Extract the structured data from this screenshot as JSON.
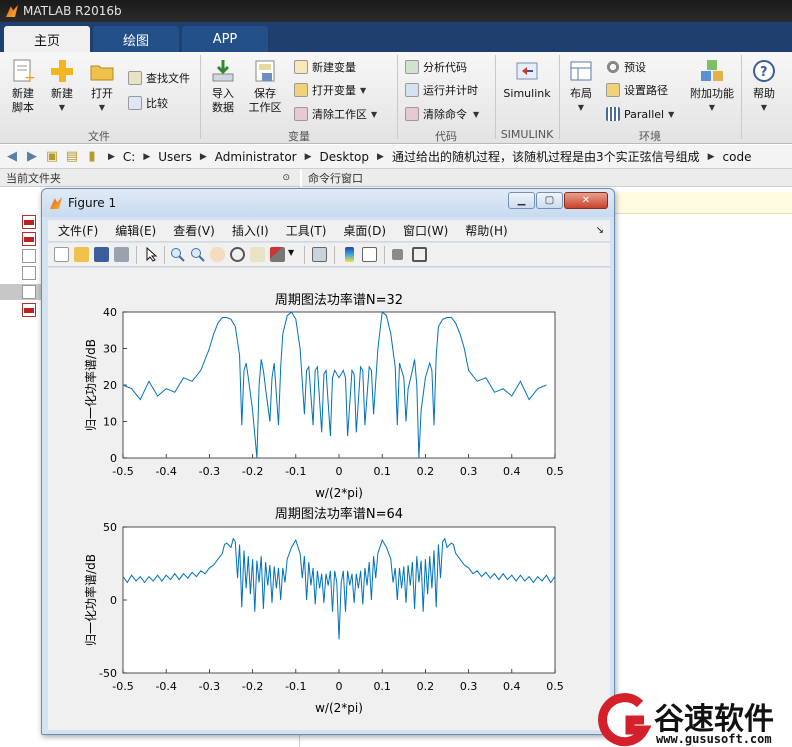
{
  "app": {
    "title": "MATLAB R2016b"
  },
  "tabs": [
    {
      "label": "主页",
      "active": true
    },
    {
      "label": "绘图",
      "active": false
    },
    {
      "label": "APP",
      "active": false
    }
  ],
  "ribbon": {
    "file": {
      "section": "文件",
      "new_script": "新建\n脚本",
      "new": "新建",
      "open": "打开",
      "find_files": "查找文件",
      "compare": "比较"
    },
    "variable": {
      "section": "变量",
      "import": "导入\n数据",
      "save_ws": "保存\n工作区",
      "new_var": "新建变量",
      "open_var": "打开变量",
      "clear_ws": "清除工作区"
    },
    "code": {
      "section": "代码",
      "analyze": "分析代码",
      "run_time": "运行并计时",
      "clear_cmd": "清除命令"
    },
    "simulink": {
      "section": "SIMULINK",
      "label": "Simulink"
    },
    "env": {
      "section": "环境",
      "layout": "布局",
      "prefs": "预设",
      "set_path": "设置路径",
      "parallel": "Parallel",
      "addons": "附加功能"
    },
    "help": "帮助"
  },
  "address": {
    "path": [
      "C:",
      "Users",
      "Administrator",
      "Desktop",
      "通过给出的随机过程，该随机过程是由3个实正弦信号组成",
      "code"
    ]
  },
  "panels": {
    "current_folder": "当前文件夹",
    "command_window": "命令行窗口"
  },
  "figure": {
    "title": "Figure 1",
    "menu": [
      "文件(F)",
      "编辑(E)",
      "查看(V)",
      "插入(I)",
      "工具(T)",
      "桌面(D)",
      "窗口(W)",
      "帮助(H)"
    ]
  },
  "chart_data": [
    {
      "type": "line",
      "title": "周期图法功率谱N=32",
      "xlabel": "w/(2*pi)",
      "ylabel": "归一化功率谱/dB",
      "xlim": [
        -0.5,
        0.5
      ],
      "ylim": [
        0,
        40
      ],
      "xticks": [
        "-0.5",
        "-0.4",
        "-0.3",
        "-0.2",
        "-0.1",
        "0",
        "0.1",
        "0.2",
        "0.3",
        "0.4",
        "0.5"
      ],
      "yticks": [
        "0",
        "10",
        "20",
        "30",
        "40"
      ],
      "color": "#0072bd",
      "x": [
        -0.5,
        -0.48,
        -0.46,
        -0.44,
        -0.42,
        -0.4,
        -0.38,
        -0.36,
        -0.34,
        -0.32,
        -0.3,
        -0.29,
        -0.28,
        -0.27,
        -0.26,
        -0.25,
        -0.24,
        -0.23,
        -0.225,
        -0.22,
        -0.215,
        -0.21,
        -0.2,
        -0.19,
        -0.185,
        -0.18,
        -0.175,
        -0.17,
        -0.16,
        -0.155,
        -0.15,
        -0.14,
        -0.135,
        -0.13,
        -0.12,
        -0.11,
        -0.1,
        -0.09,
        -0.08,
        -0.075,
        -0.07,
        -0.06,
        -0.055,
        -0.05,
        -0.04,
        -0.035,
        -0.03,
        -0.02,
        -0.015,
        -0.01,
        0,
        0.01,
        0.015,
        0.02,
        0.03,
        0.035,
        0.04,
        0.05,
        0.055,
        0.06,
        0.07,
        0.075,
        0.08,
        0.09,
        0.1,
        0.11,
        0.12,
        0.13,
        0.135,
        0.14,
        0.15,
        0.155,
        0.16,
        0.17,
        0.175,
        0.18,
        0.185,
        0.19,
        0.2,
        0.21,
        0.215,
        0.22,
        0.225,
        0.23,
        0.24,
        0.25,
        0.26,
        0.27,
        0.28,
        0.29,
        0.3,
        0.32,
        0.34,
        0.36,
        0.38,
        0.4,
        0.42,
        0.44,
        0.46,
        0.48,
        0.5
      ],
      "y": [
        20,
        19,
        16,
        21,
        17,
        19,
        18,
        22,
        21,
        24,
        30,
        34,
        37,
        38.5,
        38.5,
        38,
        36,
        28,
        9,
        24,
        26,
        22,
        13,
        0,
        20,
        27,
        24,
        19,
        10,
        22,
        26,
        9,
        25,
        34,
        39,
        40,
        38,
        30,
        12,
        24,
        25,
        9,
        24,
        25,
        7,
        23,
        24,
        6,
        22,
        24,
        22,
        24,
        22,
        6,
        24,
        23,
        7,
        25,
        24,
        9,
        25,
        24,
        12,
        30,
        40,
        39,
        34,
        25,
        9,
        26,
        22,
        10,
        19,
        24,
        27,
        20,
        0,
        13,
        22,
        26,
        24,
        9,
        28,
        36,
        38,
        38.5,
        38.5,
        37,
        34,
        30,
        24,
        21,
        22,
        18,
        19,
        17,
        21,
        16,
        19,
        20
      ]
    },
    {
      "type": "line",
      "title": "周期图法功率谱N=64",
      "xlabel": "w/(2*pi)",
      "ylabel": "归一化功率谱/dB",
      "xlim": [
        -0.5,
        0.5
      ],
      "ylim": [
        -50,
        50
      ],
      "xticks": [
        "-0.5",
        "-0.4",
        "-0.3",
        "-0.2",
        "-0.1",
        "0",
        "0.1",
        "0.2",
        "0.3",
        "0.4",
        "0.5"
      ],
      "yticks": [
        "-50",
        "0",
        "50"
      ],
      "color": "#0072bd",
      "x": [
        -0.5,
        -0.49,
        -0.48,
        -0.47,
        -0.46,
        -0.45,
        -0.44,
        -0.43,
        -0.42,
        -0.41,
        -0.4,
        -0.39,
        -0.38,
        -0.37,
        -0.36,
        -0.35,
        -0.34,
        -0.33,
        -0.32,
        -0.31,
        -0.3,
        -0.29,
        -0.28,
        -0.27,
        -0.265,
        -0.26,
        -0.25,
        -0.245,
        -0.24,
        -0.235,
        -0.23,
        -0.225,
        -0.22,
        -0.215,
        -0.21,
        -0.205,
        -0.2,
        -0.195,
        -0.19,
        -0.185,
        -0.18,
        -0.175,
        -0.17,
        -0.165,
        -0.16,
        -0.155,
        -0.15,
        -0.145,
        -0.14,
        -0.135,
        -0.13,
        -0.125,
        -0.12,
        -0.11,
        -0.1,
        -0.09,
        -0.085,
        -0.08,
        -0.075,
        -0.07,
        -0.065,
        -0.06,
        -0.055,
        -0.05,
        -0.045,
        -0.04,
        -0.035,
        -0.03,
        -0.025,
        -0.02,
        -0.015,
        -0.01,
        -0.005,
        0,
        0.005,
        0.01,
        0.015,
        0.02,
        0.025,
        0.03,
        0.035,
        0.04,
        0.045,
        0.05,
        0.055,
        0.06,
        0.065,
        0.07,
        0.075,
        0.08,
        0.085,
        0.09,
        0.1,
        0.11,
        0.12,
        0.125,
        0.13,
        0.135,
        0.14,
        0.145,
        0.15,
        0.155,
        0.16,
        0.165,
        0.17,
        0.175,
        0.18,
        0.185,
        0.19,
        0.195,
        0.2,
        0.205,
        0.21,
        0.215,
        0.22,
        0.225,
        0.23,
        0.235,
        0.24,
        0.245,
        0.25,
        0.26,
        0.265,
        0.27,
        0.28,
        0.29,
        0.3,
        0.31,
        0.32,
        0.33,
        0.34,
        0.35,
        0.36,
        0.37,
        0.38,
        0.39,
        0.4,
        0.41,
        0.42,
        0.43,
        0.44,
        0.45,
        0.46,
        0.47,
        0.48,
        0.49,
        0.5
      ],
      "y": [
        16,
        12,
        17,
        13,
        16,
        12,
        16,
        13,
        17,
        13,
        17,
        14,
        18,
        14,
        18,
        15,
        19,
        16,
        20,
        18,
        22,
        24,
        28,
        32,
        38,
        39,
        36,
        42,
        40,
        15,
        38,
        -5,
        34,
        8,
        30,
        4,
        28,
        -8,
        27,
        12,
        30,
        -6,
        26,
        10,
        24,
        -2,
        23,
        8,
        22,
        0,
        22,
        12,
        28,
        36,
        41,
        32,
        15,
        30,
        0,
        26,
        10,
        22,
        -3,
        20,
        8,
        18,
        -2,
        18,
        10,
        20,
        -8,
        20,
        12,
        -27,
        12,
        20,
        -8,
        20,
        10,
        18,
        -2,
        18,
        8,
        20,
        -3,
        22,
        10,
        26,
        0,
        30,
        15,
        32,
        41,
        36,
        28,
        12,
        22,
        0,
        22,
        8,
        23,
        -2,
        24,
        10,
        26,
        -6,
        30,
        12,
        27,
        -8,
        28,
        4,
        30,
        8,
        34,
        -5,
        38,
        15,
        40,
        42,
        36,
        39,
        38,
        32,
        28,
        24,
        22,
        18,
        20,
        16,
        19,
        15,
        18,
        14,
        18,
        14,
        17,
        13,
        17,
        13,
        16,
        12,
        16,
        13,
        17,
        12,
        16
      ]
    }
  ],
  "watermark": {
    "brand": "谷速软件",
    "url": "www.gususoft.com"
  }
}
